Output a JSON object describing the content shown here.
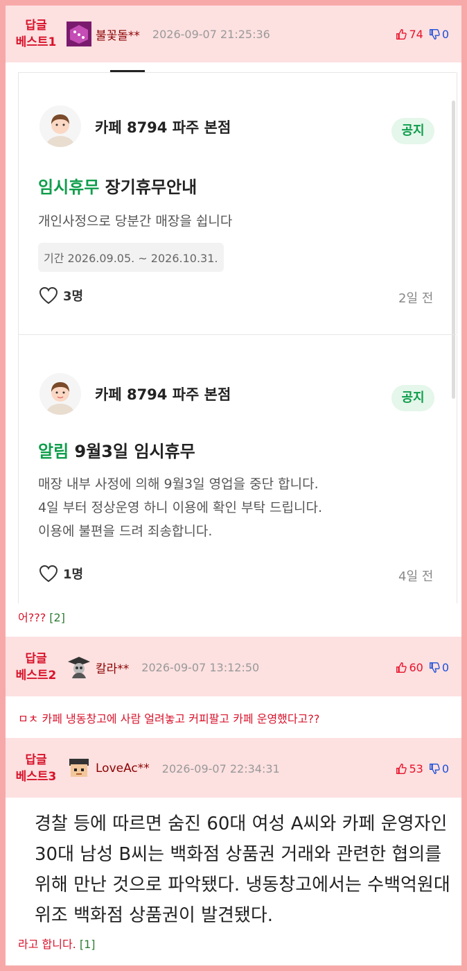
{
  "best1": {
    "badge_line1": "답글",
    "badge_line2": "베스트1",
    "nick": "불꽃돌**",
    "date": "2026-09-07 21:25:36",
    "up": "74",
    "down": "0"
  },
  "image_cards": [
    {
      "cafe_name": "카페 8794 파주 본점",
      "notice": "공지",
      "title_green": "임시휴무",
      "title_rest": " 장기휴무안내",
      "body_lines": [
        "개인사정으로 당분간 매장을 쉽니다"
      ],
      "period": "기간 2026.09.05. ~ 2026.10.31.",
      "likes": "3명",
      "ago": "2일 전"
    },
    {
      "cafe_name": "카페 8794 파주 본점",
      "notice": "공지",
      "title_green": "알림",
      "title_rest": " 9월3일 임시휴무",
      "body_lines": [
        "매장 내부 사정에 의해 9월3일 영업을 중단 합니다.",
        "4일 부터 정상운영 하니 이용에 확인 부탁 드립니다.",
        "이용에 불편을 드려 죄송합니다."
      ],
      "likes": "1명",
      "ago": "4일 전"
    }
  ],
  "comment1": {
    "text": "어???",
    "count": "[2]"
  },
  "best2": {
    "badge_line1": "답글",
    "badge_line2": "베스트2",
    "nick": "칼라**",
    "date": "2026-09-07 13:12:50",
    "up": "60",
    "down": "0"
  },
  "comment2": {
    "text": "ㅁㅊ 카페 냉동창고에 사람 얼려놓고 커피팔고 카페 운영했다고??"
  },
  "best3": {
    "badge_line1": "답글",
    "badge_line2": "베스트3",
    "nick": "LoveAc**",
    "date": "2026-09-07 22:34:31",
    "up": "53",
    "down": "0"
  },
  "article_quote": "경찰 등에 따르면 숨진 60대 여성 A씨와 카페 운영자인 30대 남성 B씨는 백화점 상품권 거래와 관련한 협의를 위해 만난 것으로 파악됐다. 냉동창고에서는 수백억원대 위조 백화점 상품권이 발견됐다.",
  "comment3": {
    "text": "라고 합니다.",
    "count": "[1]"
  },
  "colors": {
    "accent_red": "#d8122a",
    "header_pink": "#fde0e0",
    "border_pink": "#f7a9a9",
    "green": "#0e9d4b",
    "down_blue": "#1d4fd8"
  }
}
